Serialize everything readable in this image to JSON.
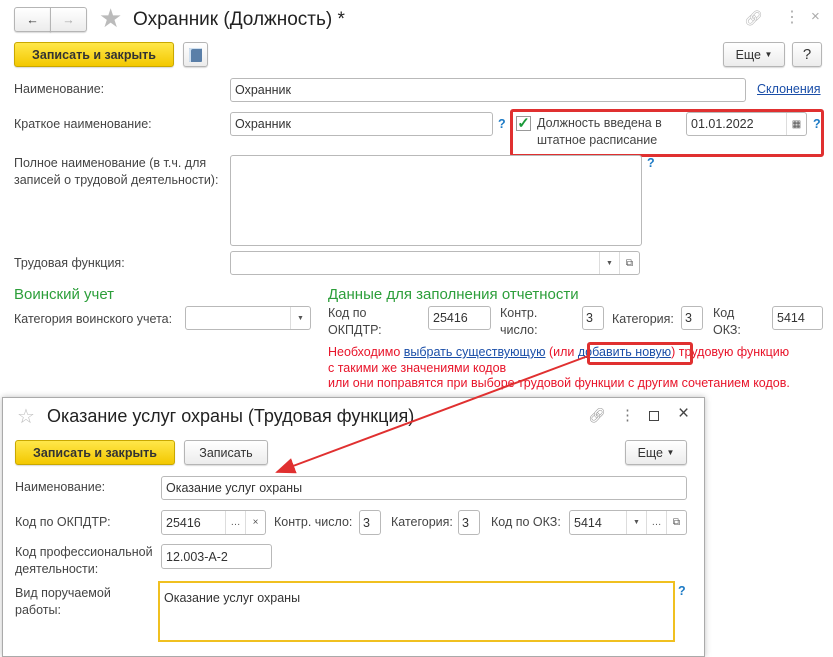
{
  "main": {
    "title": "Охранник (Должность) *",
    "save_close": "Записать и закрыть",
    "more": "Еще",
    "help": "?",
    "name_label": "Наименование:",
    "name_value": "Охранник",
    "declensions": "Склонения",
    "short_label": "Краткое наименование:",
    "short_value": "Охранник",
    "staff_checkbox_label": "Должность введена в штатное расписание",
    "staff_checked": true,
    "staff_date": "01.01.2022",
    "full_label": "Полное наименование (в т.ч. для записей о трудовой деятельности):",
    "full_value": "",
    "labor_function_label": "Трудовая функция:",
    "labor_function_value": "",
    "military_heading": "Воинский учет",
    "military_category_label": "Категория воинского учета:",
    "military_category_value": "",
    "report_heading": "Данные для заполнения отчетности",
    "okpdtr_label": "Код по ОКПДТР:",
    "okpdtr_value": "25416",
    "control_label": "Контр. число:",
    "control_value": "3",
    "category_label": "Категория:",
    "category_value": "3",
    "okz_label": "Код ОКЗ:",
    "okz_value": "5414",
    "warning": {
      "p1": "Необходимо ",
      "link1": "выбрать существующую",
      "p2": " (или ",
      "link2": "добавить новую",
      "p3": ") трудовую функцию",
      "line2": "с такими же значениями кодов",
      "line3": "или они поправятся при выборе трудовой функции с другим сочетанием кодов."
    }
  },
  "popup": {
    "title": "Оказание услуг охраны (Трудовая функция)",
    "save_close": "Записать и закрыть",
    "save": "Записать",
    "more": "Еще",
    "name_label": "Наименование:",
    "name_value": "Оказание услуг охраны",
    "okpdtr_label": "Код по ОКПДТР:",
    "okpdtr_value": "25416",
    "control_label": "Контр. число:",
    "control_value": "3",
    "category_label": "Категория:",
    "category_value": "3",
    "okz_label": "Код по ОКЗ:",
    "okz_value": "5414",
    "prof_label": "Код профессиональной деятельности:",
    "prof_value": "12.003-А-2",
    "work_label": "Вид поручаемой работы:",
    "work_value": "Оказание услуг охраны"
  },
  "colors": {
    "accent_yellow": "#f3c800",
    "heading_green": "#2c9e3a",
    "warning_red": "#e8142a",
    "annotation_red": "#e03030",
    "link_blue": "#1a4ea8"
  }
}
